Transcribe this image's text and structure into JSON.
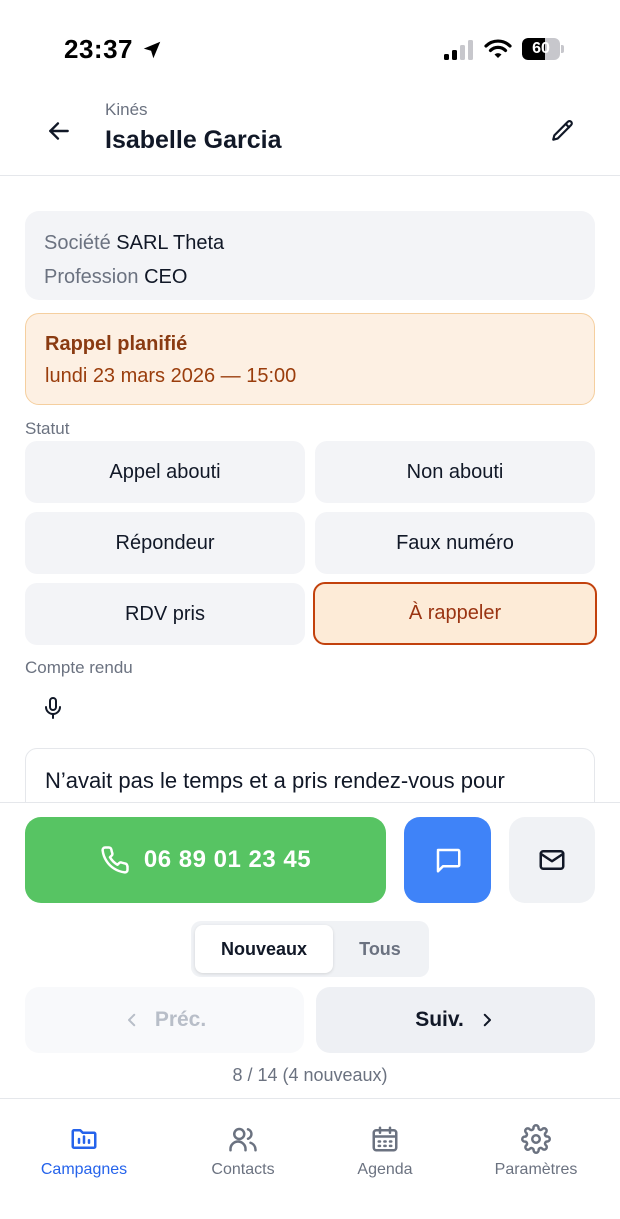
{
  "status_bar": {
    "time": "23:37",
    "battery_level": "60",
    "battery_fraction": 0.6
  },
  "header": {
    "subtitle": "Kinés",
    "title": "Isabelle Garcia"
  },
  "info": {
    "company_label": "Société",
    "company_value": "SARL Theta",
    "profession_label": "Profession",
    "profession_value": "CEO"
  },
  "reminder": {
    "title": "Rappel planifié",
    "date": "lundi 23 mars 2026 — 15:00"
  },
  "status_section": {
    "label": "Statut",
    "options": [
      "Appel abouti",
      "Non abouti",
      "Répondeur",
      "Faux numéro",
      "RDV pris",
      "À rappeler"
    ],
    "selected": "À rappeler"
  },
  "report": {
    "label": "Compte rendu",
    "text": "N’avait pas le temps et a pris rendez-vous pour"
  },
  "actions": {
    "phone": "06 89 01 23 45"
  },
  "filter": {
    "tabs": [
      "Nouveaux",
      "Tous"
    ],
    "active": "Nouveaux"
  },
  "pager": {
    "prev": "Préc.",
    "next": "Suiv.",
    "counter": "8 / 14 (4 nouveaux)"
  },
  "tabbar": {
    "items": [
      {
        "label": "Campagnes",
        "icon": "folder-chart-icon"
      },
      {
        "label": "Contacts",
        "icon": "users-icon"
      },
      {
        "label": "Agenda",
        "icon": "calendar-icon"
      },
      {
        "label": "Paramètres",
        "icon": "gear-icon"
      }
    ],
    "active": "Campagnes"
  },
  "colors": {
    "call_green": "#57c463",
    "sms_blue": "#3f83f8",
    "accent_orange": "#c2410c",
    "reminder_bg": "#fdf0e3",
    "active_tab_blue": "#2563eb"
  }
}
